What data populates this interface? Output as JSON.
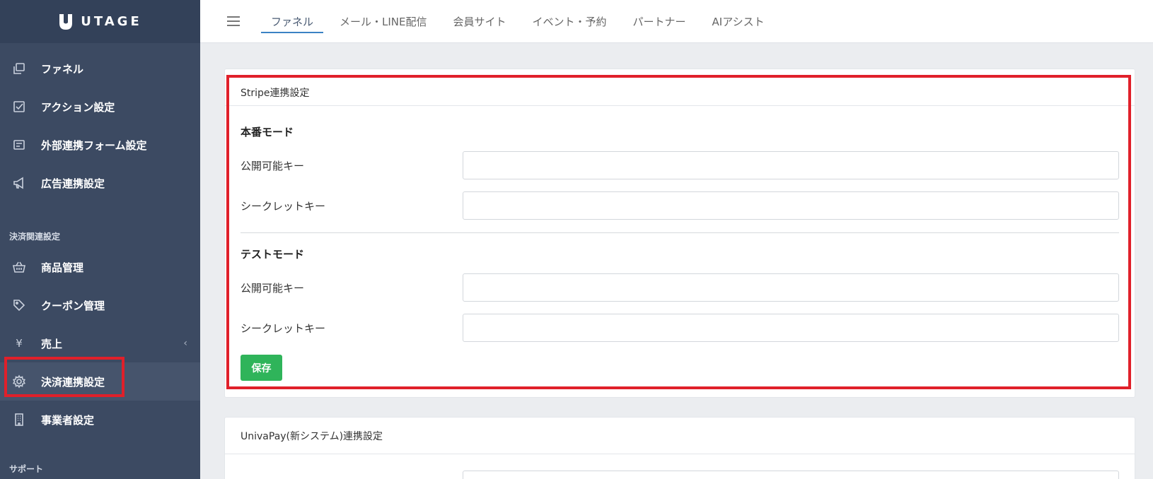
{
  "brand": {
    "name": "UTAGE"
  },
  "sidebar": {
    "items_top": [
      {
        "label": "ファネル",
        "icon": "copy-icon"
      },
      {
        "label": "アクション設定",
        "icon": "checkbox-icon"
      },
      {
        "label": "外部連携フォーム設定",
        "icon": "form-icon"
      },
      {
        "label": "広告連携設定",
        "icon": "megaphone-icon"
      }
    ],
    "section_payment": "決済関連設定",
    "items_payment": [
      {
        "label": "商品管理",
        "icon": "basket-icon"
      },
      {
        "label": "クーポン管理",
        "icon": "tag-icon"
      },
      {
        "label": "売上",
        "icon": "yen-icon",
        "chevron": "‹"
      },
      {
        "label": "決済連携設定",
        "icon": "gear-icon"
      },
      {
        "label": "事業者設定",
        "icon": "building-icon"
      }
    ],
    "section_support": "サポート",
    "yen_glyph": "¥"
  },
  "topbar": {
    "tabs": [
      "ファネル",
      "メール・LINE配信",
      "会員サイト",
      "イベント・予約",
      "パートナー",
      "AIアシスト"
    ],
    "active_tab": "ファネル"
  },
  "stripe": {
    "title": "Stripe連携設定",
    "live_mode_title": "本番モード",
    "test_mode_title": "テストモード",
    "public_key_label": "公開可能キー",
    "secret_key_label": "シークレットキー",
    "live_public_key": "",
    "live_secret_key": "",
    "test_public_key": "",
    "test_secret_key": "",
    "save_label": "保存"
  },
  "univapay": {
    "title": "UnivaPay(新システム)連携設定"
  },
  "colors": {
    "sidebar_bg": "#3c4a62",
    "brand_bg": "#334159",
    "highlight": "#e0202a",
    "save_button": "#2fb45a",
    "tab_underline": "#3b82c4"
  }
}
